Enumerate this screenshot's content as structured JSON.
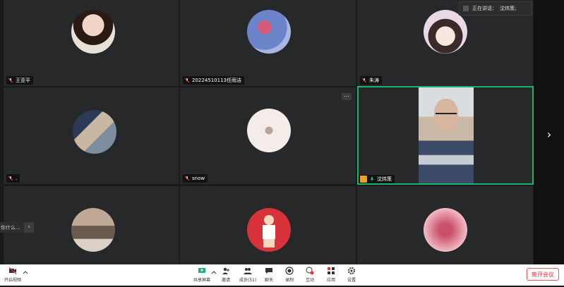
{
  "speaking_banner": {
    "label": "正在讲话：",
    "name": "沈炜策;"
  },
  "side_chip": {
    "text": "你什么...",
    "chevron": "‹"
  },
  "next_arrow": "›",
  "participants": [
    {
      "name": "王亚平",
      "avatar": "girl-with-cat"
    },
    {
      "name": "20224510113任雨洁",
      "avatar": "person-in-blue"
    },
    {
      "name": "朱涛",
      "avatar": "anime-girl"
    },
    {
      "name": ".",
      "avatar": "child-walking"
    },
    {
      "name": "snow",
      "avatar": "snow-landscape"
    },
    {
      "name": "沈炜策",
      "avatar": "live-video",
      "active": true
    },
    {
      "name": "",
      "avatar": "room-photo"
    },
    {
      "name": "",
      "avatar": "cartoon-figure-red"
    },
    {
      "name": "",
      "avatar": "pink-blur"
    }
  ],
  "more_button": "...",
  "toolbar": {
    "video": "开启视频",
    "share": "共享屏幕",
    "invite": "邀请",
    "members": "成员(51)",
    "chat": "聊天",
    "record": "录制",
    "reaction": "互动",
    "apps": "应用",
    "settings": "设置",
    "leave": "离开会议"
  },
  "colors": {
    "active_border": "#1db36b",
    "leave_red": "#e33",
    "mic_green": "#28c76f",
    "share_green": "#1db36b"
  }
}
